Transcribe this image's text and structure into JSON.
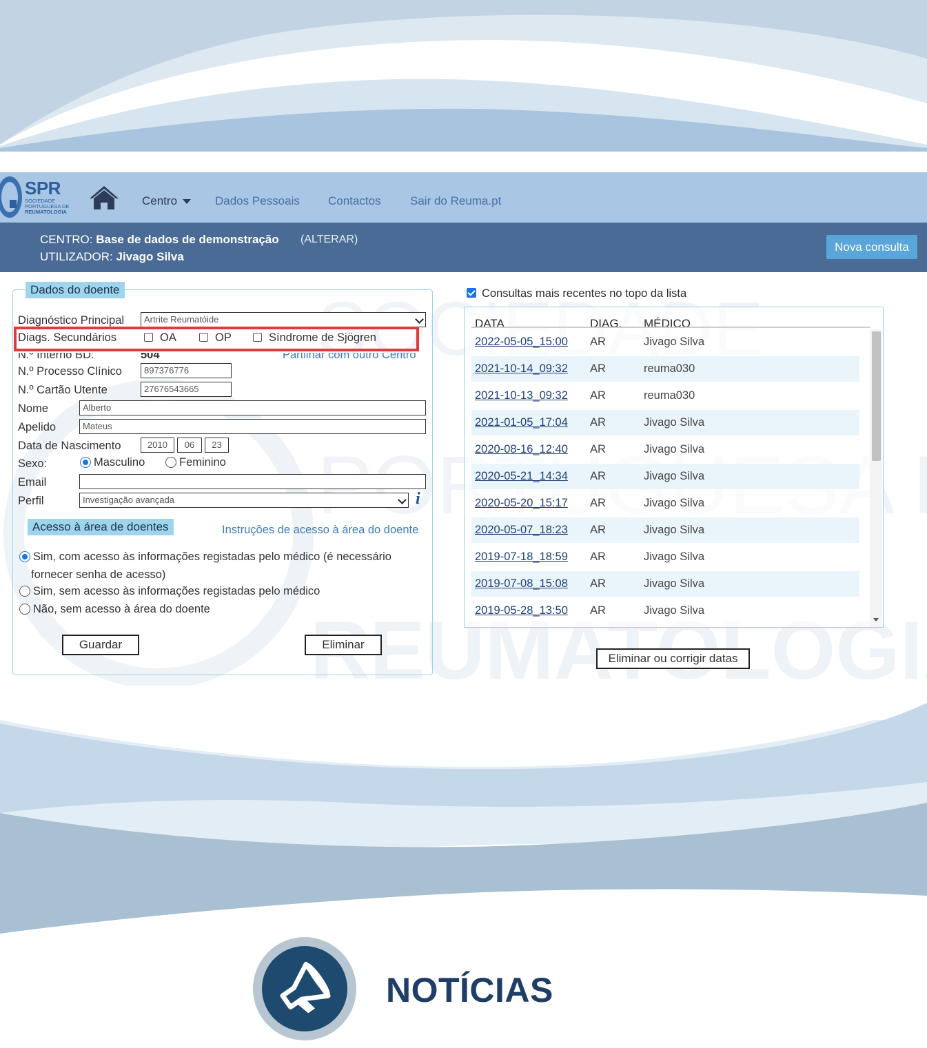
{
  "nav": {
    "logo_text": "SPR",
    "logo_sub_1": "SOCIEDADE",
    "logo_sub_2": "PORTUGUESA DE",
    "logo_sub_3": "REUMATOLOGIA",
    "centro": "Centro",
    "dados_pessoais": "Dados Pessoais",
    "contactos": "Contactos",
    "sair": "Sair do Reuma.pt"
  },
  "header": {
    "centro_label": "CENTRO:",
    "centro_value": "Base de dados de demonstração",
    "alterar": "(ALTERAR)",
    "user_label": "UTILIZADOR:",
    "user_value": "Jivago Silva",
    "nova_consulta": "Nova consulta"
  },
  "patient": {
    "legend": "Dados do doente",
    "diag_principal_label": "Diagnóstico Principal",
    "diag_principal_value": "Artrite Reumatóide",
    "diags_secundarios_label": "Diags. Secundários",
    "sec_oa": "OA",
    "sec_op": "OP",
    "sec_sjogren": "Síndrome de Sjögren",
    "interno_label": "N.º Interno BD:",
    "interno_value": "504",
    "partilhar": "Partilhar com outro Centro",
    "processo_label": "N.º Processo Clínico",
    "processo_value": "897376776",
    "cartao_label": "N.º Cartão Utente",
    "cartao_value": "27676543665",
    "nome_label": "Nome",
    "nome_value": "Alberto",
    "apelido_label": "Apelido",
    "apelido_value": "Mateus",
    "nascimento_label": "Data de Nascimento",
    "nasc_ano": "2010",
    "nasc_mes": "06",
    "nasc_dia": "23",
    "sexo_label": "Sexo:",
    "sexo_m": "Masculino",
    "sexo_f": "Feminino",
    "email_label": "Email",
    "email_value": "",
    "perfil_label": "Perfil",
    "perfil_value": "Investigação avançada"
  },
  "access": {
    "legend": "Acesso à área de doentes",
    "instrucoes": "Instruções de acesso à área do doente",
    "opt1_line1": "Sim, com acesso às informações registadas pelo médico (é necessário",
    "opt1_line2": "fornecer senha de acesso)",
    "opt2": "Sim, sem acesso às informações registadas pelo médico",
    "opt3": "Não, sem acesso à área do doente",
    "guardar": "Guardar",
    "eliminar": "Eliminar"
  },
  "consultas": {
    "topo_label": "Consultas mais recentes no topo da lista",
    "col_data": "DATA",
    "col_diag": "DIAG.",
    "col_medico": "MÉDICO",
    "rows": [
      {
        "date": "2022-05-05_15:00",
        "diag": "AR",
        "medico": "Jivago Silva"
      },
      {
        "date": "2021-10-14_09:32",
        "diag": "AR",
        "medico": "reuma030"
      },
      {
        "date": "2021-10-13_09:32",
        "diag": "AR",
        "medico": "reuma030"
      },
      {
        "date": "2021-01-05_17:04",
        "diag": "AR",
        "medico": "Jivago Silva"
      },
      {
        "date": "2020-08-16_12:40",
        "diag": "AR",
        "medico": "Jivago Silva"
      },
      {
        "date": "2020-05-21_14:34",
        "diag": "AR",
        "medico": "Jivago Silva"
      },
      {
        "date": "2020-05-20_15:17",
        "diag": "AR",
        "medico": "Jivago Silva"
      },
      {
        "date": "2020-05-07_18:23",
        "diag": "AR",
        "medico": "Jivago Silva"
      },
      {
        "date": "2019-07-18_18:59",
        "diag": "AR",
        "medico": "Jivago Silva"
      },
      {
        "date": "2019-07-08_15:08",
        "diag": "AR",
        "medico": "Jivago Silva"
      },
      {
        "date": "2019-05-28_13:50",
        "diag": "AR",
        "medico": "Jivago Silva"
      }
    ],
    "eliminar_corrigir": "Eliminar ou corrigir datas"
  },
  "news": {
    "title": "NOTÍCIAS"
  },
  "watermark": {
    "line1": "SOCIEDADE",
    "line2": "PORTUGUESA DE",
    "line3": "REUMATOLOGIA"
  },
  "colors": {
    "navbar": "#a9c6e4",
    "centro_bar": "#4a6b95",
    "accent": "#5aa5d9",
    "highlight": "#e03a3a",
    "news_title": "#1e3e66"
  }
}
